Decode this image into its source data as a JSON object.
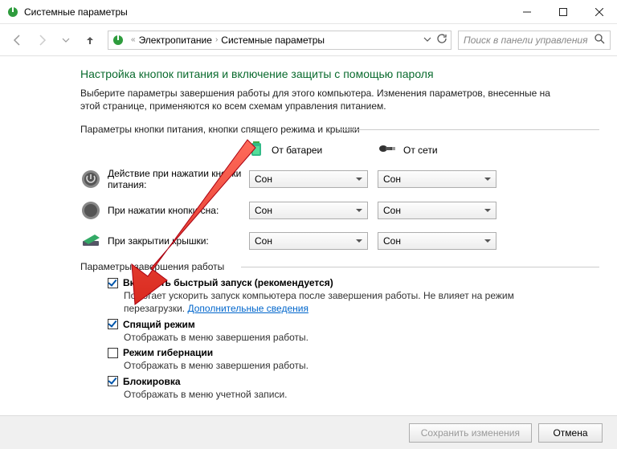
{
  "window": {
    "title": "Системные параметры"
  },
  "breadcrumb": {
    "item1": "Электропитание",
    "item2": "Системные параметры"
  },
  "search": {
    "placeholder": "Поиск в панели управления"
  },
  "page": {
    "heading": "Настройка кнопок питания и включение защиты с помощью пароля",
    "intro": "Выберите параметры завершения работы для этого компьютера. Изменения параметров, внесенные на этой странице, применяются ко всем схемам управления питанием.",
    "section1_label": "Параметры кнопки питания, кнопки спящего режима и крышки",
    "col_battery": "От батареи",
    "col_ac": "От сети",
    "row_power_label": "Действие при нажатии кнопки питания:",
    "row_sleep_label": "При нажатии кнопки сна:",
    "row_lid_label": "При закрытии крышки:",
    "dd_value": "Сон",
    "section2_label": "Параметры завершения работы",
    "cb_fast_label": "Включить быстрый запуск (рекомендуется)",
    "cb_fast_desc": "Помогает ускорить запуск компьютера после завершения работы. Не влияет на режим перезагрузки. ",
    "cb_fast_link": "Дополнительные сведения",
    "cb_sleep_label": "Спящий режим",
    "cb_sleep_desc": "Отображать в меню завершения работы.",
    "cb_hiber_label": "Режим гибернации",
    "cb_hiber_desc": "Отображать в меню завершения работы.",
    "cb_lock_label": "Блокировка",
    "cb_lock_desc": "Отображать в меню учетной записи.",
    "btn_save": "Сохранить изменения",
    "btn_cancel": "Отмена"
  },
  "checkboxes": {
    "fast": true,
    "sleep": true,
    "hiber": false,
    "lock": true
  }
}
